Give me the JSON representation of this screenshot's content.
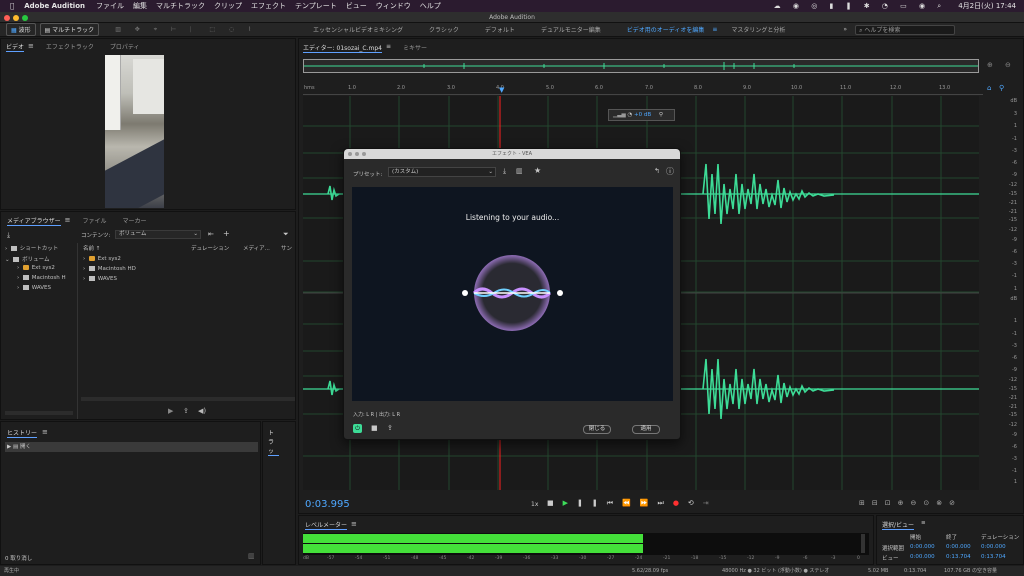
{
  "menubar": {
    "app": "Adobe Audition",
    "items": [
      "ファイル",
      "編集",
      "マルチトラック",
      "クリップ",
      "エフェクト",
      "テンプレート",
      "ビュー",
      "ウィンドウ",
      "ヘルプ"
    ],
    "clock": "4月2日(火)  17:44"
  },
  "window": {
    "title": "Adobe Audition"
  },
  "toolbar": {
    "mode_waveform": "波形",
    "mode_multitrack": "マルチトラック",
    "workspaces": [
      "エッセンシャルビデオミキシング",
      "クラシック",
      "デフォルト",
      "デュアルモニター編集",
      "ビデオ用のオーディオを編集",
      "マスタリングと分析"
    ],
    "active_workspace": "ビデオ用のオーディオを編集",
    "search_placeholder": "ヘルプを検索"
  },
  "video_panel": {
    "tabs": [
      "ビデオ",
      "エフェクトラック",
      "プロパティ"
    ]
  },
  "media_browser": {
    "tabs": [
      "メディアブラウザー",
      "ファイル",
      "マーカー"
    ],
    "contents_label": "コンテンツ:",
    "contents_value": "ボリューム",
    "tree": [
      "ショートカット",
      "ボリューム",
      "Ext sys2",
      "Macintosh H",
      "WAVES"
    ],
    "columns": [
      "名前",
      "デュレーション",
      "メディア...",
      "サン"
    ],
    "files": [
      "Ext sys2",
      "Macintosh HD",
      "WAVES"
    ]
  },
  "history": {
    "tab": "ヒストリー",
    "item": "開く",
    "undo": "0 取り消し",
    "other_tab": "トラッ"
  },
  "status": {
    "left": "再生中",
    "fps": "5.62/28.09 fps",
    "format": "48000 Hz ● 32 ビット (浮動小数) ● ステレオ",
    "size": "5.02 MB",
    "duration": "0:13.704",
    "free": "107.76 GB の空き容量"
  },
  "editor": {
    "tabs": [
      "エディター: 01sozai_C.mp4",
      "ミキサー"
    ],
    "ruler": [
      "hms",
      "1.0",
      "2.0",
      "3.0",
      "4.0",
      "5.0",
      "6.0",
      "7.0",
      "8.0",
      "9.0",
      "10.0",
      "11.0",
      "12.0",
      "13.0"
    ],
    "db_ticks_top": [
      "dB",
      "3",
      "1",
      "-1",
      "-3",
      "-6",
      "-9",
      "-12",
      "-15",
      "-21",
      "-21",
      "-15",
      "-12",
      "-9",
      "-6",
      "-3",
      "-1",
      "1",
      "3"
    ],
    "db_ticks_bottom": [
      "dB",
      "1",
      "-1",
      "-3",
      "-6",
      "-9",
      "-12",
      "-15",
      "-21",
      "-21",
      "-15",
      "-12",
      "-9",
      "-6",
      "-3",
      "-1",
      "1",
      "3"
    ],
    "gain": "+0 dB",
    "timecode": "0:03.995",
    "speed": "1x"
  },
  "vea": {
    "title": "エフェクト - VEA",
    "preset_label": "プリセット:",
    "preset_value": "(カスタム)",
    "listening": "Listening to your audio...",
    "io": "入力: L R | 出力: L R",
    "close": "閉じる",
    "apply": "適用"
  },
  "level_meter": {
    "tab": "レベルメーター",
    "scale": [
      "dB",
      "-57",
      "-54",
      "-51",
      "-48",
      "-45",
      "-42",
      "-39",
      "-36",
      "-33",
      "-30",
      "-27",
      "-24",
      "-21",
      "-18",
      "-15",
      "-12",
      "-9",
      "-6",
      "-3",
      "0"
    ],
    "level_fraction": 0.6
  },
  "selection_view": {
    "tab": "選択/ビュー",
    "headers": [
      "開始",
      "終了",
      "デュレーション"
    ],
    "rows": [
      {
        "label": "選択範囲",
        "start": "0:00.000",
        "end": "0:00.000",
        "dur": "0:00.000"
      },
      {
        "label": "ビュー",
        "start": "0:00.000",
        "end": "0:13.704",
        "dur": "0:13.704"
      }
    ]
  },
  "colors": {
    "waveform": "#3ddc97",
    "accent": "#4fa8ff",
    "level": "#44e03a",
    "playhead": "#ff2020"
  }
}
